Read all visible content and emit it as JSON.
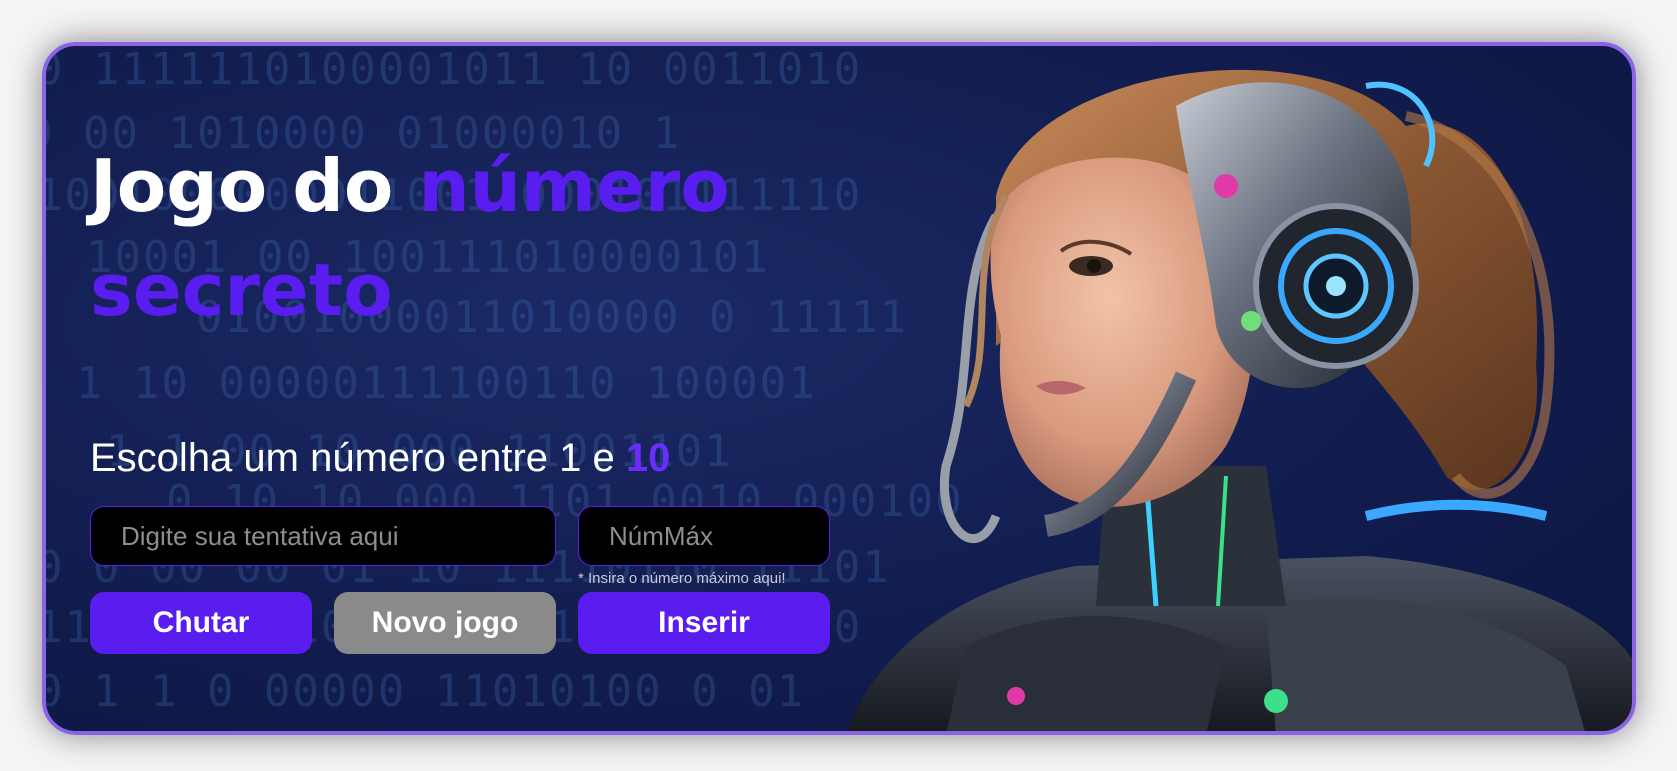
{
  "title": {
    "part1": "Jogo do ",
    "part2": "número",
    "part3": "secreto"
  },
  "subtitle": {
    "text": "Escolha um número entre 1 e ",
    "max": "10"
  },
  "guess_input": {
    "placeholder": "Digite sua tentativa aqui",
    "value": ""
  },
  "max_input": {
    "placeholder": "NúmMáx",
    "value": ""
  },
  "hint": "* Insira o número máximo aqui!",
  "buttons": {
    "guess": "Chutar",
    "new_game": "Novo jogo",
    "insert": "Inserir"
  },
  "colors": {
    "accent": "#5a1df0",
    "border": "#8a63e6",
    "background": "#121d4f",
    "secondary_button": "#8a8a8a"
  },
  "image": {
    "icon": "cyborg-girl-illustration"
  }
}
